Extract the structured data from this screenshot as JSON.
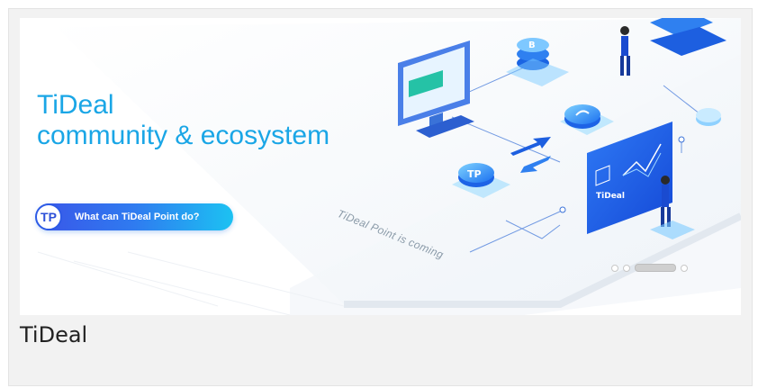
{
  "banner": {
    "headline_line1": "TiDeal",
    "headline_line2": "community & ecosystem",
    "cta_logo": "TP",
    "cta_label": "What can TiDeal Point do?",
    "tagline": "TiDeal Point is coming",
    "screen_brand": "TiDeal",
    "coin_b": "B",
    "coin_tp": "TP",
    "accent_color": "#1aa6e6",
    "carousel": {
      "slide_count": 4,
      "active_index": 2
    }
  },
  "caption": {
    "title": "TiDeal"
  }
}
